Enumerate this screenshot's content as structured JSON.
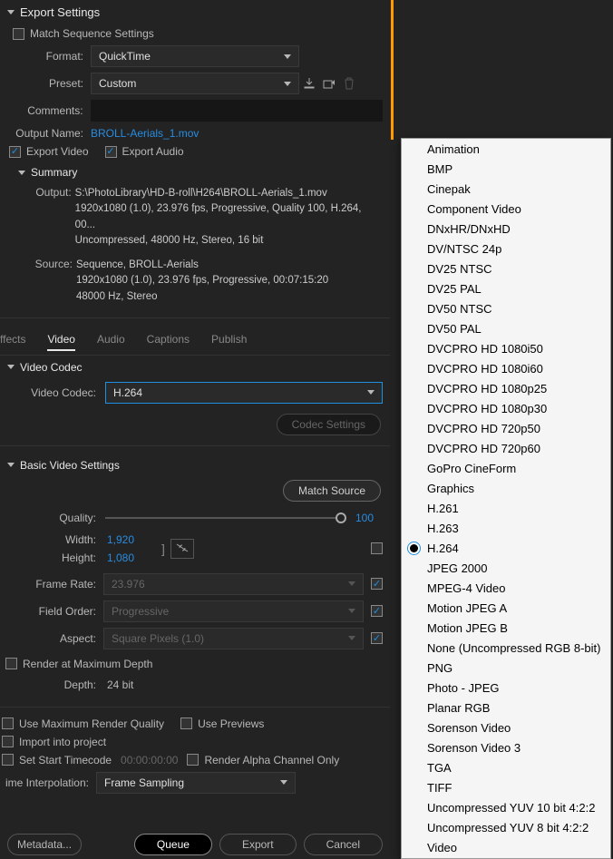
{
  "header": {
    "title": "Export Settings"
  },
  "matchSeq": "Match Sequence Settings",
  "format": {
    "label": "Format:",
    "value": "QuickTime"
  },
  "preset": {
    "label": "Preset:",
    "value": "Custom"
  },
  "comments": {
    "label": "Comments:"
  },
  "outputName": {
    "label": "Output Name:",
    "value": "BROLL-Aerials_1.mov"
  },
  "exportVideo": "Export Video",
  "exportAudio": "Export Audio",
  "summary": {
    "title": "Summary",
    "outputLabel": "Output:",
    "outputLines": [
      "S:\\PhotoLibrary\\HD-B-roll\\H264\\BROLL-Aerials_1.mov",
      "1920x1080 (1.0), 23.976 fps, Progressive, Quality 100, H.264, 00...",
      "Uncompressed, 48000 Hz, Stereo, 16 bit"
    ],
    "sourceLabel": "Source:",
    "sourceLines": [
      "Sequence, BROLL-Aerials",
      "1920x1080 (1.0), 23.976 fps, Progressive, 00:07:15:20",
      "48000 Hz, Stereo"
    ]
  },
  "tabs": {
    "effects": "ffects",
    "video": "Video",
    "audio": "Audio",
    "captions": "Captions",
    "publish": "Publish"
  },
  "videoCodec": {
    "title": "Video Codec",
    "label": "Video Codec:",
    "value": "H.264",
    "settingsBtn": "Codec Settings"
  },
  "basic": {
    "title": "Basic Video Settings",
    "matchSrc": "Match Source",
    "quality": {
      "label": "Quality:",
      "value": "100"
    },
    "width": {
      "label": "Width:",
      "value": "1,920"
    },
    "height": {
      "label": "Height:",
      "value": "1,080"
    },
    "frameRate": {
      "label": "Frame Rate:",
      "value": "23.976"
    },
    "fieldOrder": {
      "label": "Field Order:",
      "value": "Progressive"
    },
    "aspect": {
      "label": "Aspect:",
      "value": "Square Pixels (1.0)"
    },
    "renderMax": "Render at Maximum Depth",
    "depth": {
      "label": "Depth:",
      "value": "24 bit"
    }
  },
  "footer": {
    "useMaxQuality": "Use Maximum Render Quality",
    "usePreviews": "Use Previews",
    "importProject": "Import into project",
    "setStartTC": "Set Start Timecode",
    "tcValue": "00:00:00:00",
    "renderAlpha": "Render Alpha Channel Only",
    "timeInterp": {
      "label": "ime Interpolation:",
      "value": "Frame Sampling"
    }
  },
  "buttons": {
    "metadata": "Metadata...",
    "queue": "Queue",
    "export": "Export",
    "cancel": "Cancel"
  },
  "codecMenu": {
    "items": [
      "Animation",
      "BMP",
      "Cinepak",
      "Component Video",
      "DNxHR/DNxHD",
      "DV/NTSC 24p",
      "DV25 NTSC",
      "DV25 PAL",
      "DV50 NTSC",
      "DV50 PAL",
      "DVCPRO HD 1080i50",
      "DVCPRO HD 1080i60",
      "DVCPRO HD 1080p25",
      "DVCPRO HD 1080p30",
      "DVCPRO HD 720p50",
      "DVCPRO HD 720p60",
      "GoPro CineForm",
      "Graphics",
      "H.261",
      "H.263",
      "H.264",
      "JPEG 2000",
      "MPEG-4 Video",
      "Motion JPEG A",
      "Motion JPEG B",
      "None (Uncompressed RGB 8-bit)",
      "PNG",
      "Photo - JPEG",
      "Planar RGB",
      "Sorenson Video",
      "Sorenson Video 3",
      "TGA",
      "TIFF",
      "Uncompressed YUV 10 bit 4:2:2",
      "Uncompressed YUV 8 bit 4:2:2",
      "Video"
    ],
    "selected": "H.264"
  }
}
